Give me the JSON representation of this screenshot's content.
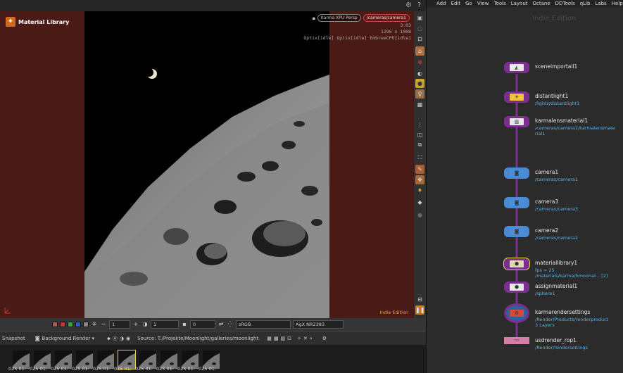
{
  "viewport": {
    "node_label": "Material Library",
    "camera_menu": "Karma XPU Persp",
    "camera_select": "/cameras/camera1",
    "render_time": "3:03",
    "resolution": "1296 x 1008",
    "devices": "Optix[idle] Optix[idle] EmbreeCPU[idle]",
    "watermark": "Indie Edition"
  },
  "bottom_bar": {
    "field1": "1",
    "field2": "1",
    "field3": "0",
    "colorspace": "sRGB",
    "display": "AgX NR2383"
  },
  "snapshot_bar": {
    "snapshot_label": "Snapshot",
    "background_render": "Background Render",
    "source_text": "Source: T:/Projekte/Moonlight/galleries/moonlight."
  },
  "thumbnails": [
    "025 01:",
    "025 01:",
    "025 01:",
    "025 01:",
    "025 01:",
    "025 01:",
    "025 01:",
    "025 01:",
    "025 01:",
    "025 01:"
  ],
  "menubar": [
    "Add",
    "Edit",
    "Go",
    "View",
    "Tools",
    "Layout",
    "Octane",
    "DDTools",
    "qLib",
    "Labs",
    "Help"
  ],
  "network": {
    "watermark": "Indie Edition",
    "nodes": [
      {
        "name": "sceneimportall1",
        "path": ""
      },
      {
        "name": "distantlight1",
        "path": "/lights/distantlight1"
      },
      {
        "name": "karmalensmaterial1",
        "path": "/cameras/camera1/karmalensmate\nrial1"
      },
      {
        "name": "camera1",
        "path": "/cameras/camera1"
      },
      {
        "name": "camera3",
        "path": "/cameras/camera3"
      },
      {
        "name": "camera2",
        "path": "/cameras/camera2"
      },
      {
        "name": "materiallibrary1",
        "path": "fps = 25\n/materials/karma/hmoonal... [2]"
      },
      {
        "name": "assignmaterial1",
        "path": "/sphere1"
      },
      {
        "name": "karmarendersettings",
        "path": "/Render/Products/renderproduct\n3 Layers"
      },
      {
        "name": "usdrender_rop1",
        "path": "/Render/rendersettings"
      }
    ]
  }
}
